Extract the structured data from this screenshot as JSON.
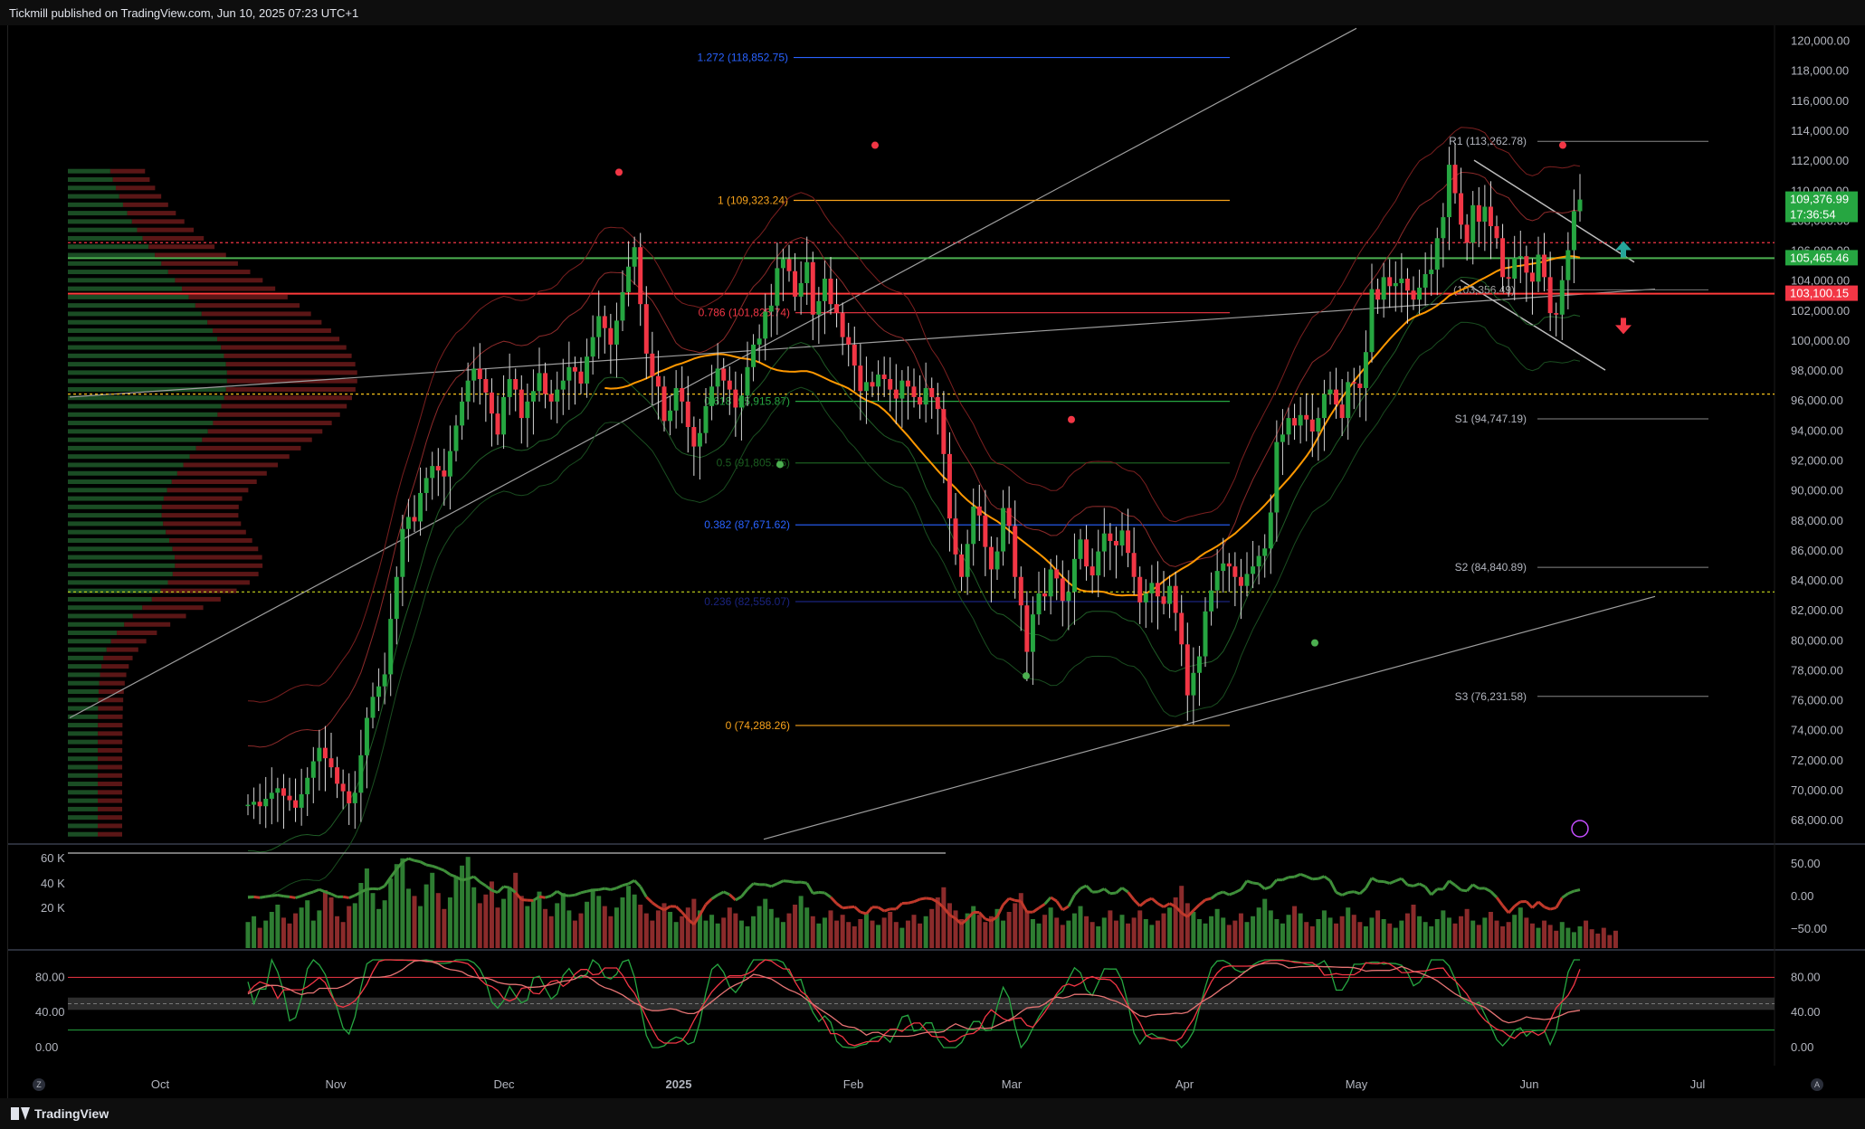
{
  "header": {
    "publisher": "Tickmill published on TradingView.com, Jun 10, 2025 07:23 UTC+1"
  },
  "footer": {
    "brand": "TradingView",
    "left_btn": "Z",
    "right_btn": "A"
  },
  "colors": {
    "up": "#26a641",
    "down": "#f23645",
    "fib_blue": "#2962ff",
    "fib_orange": "#f7a21b",
    "green_line": "#4caf50",
    "red_line": "#ff3b3b",
    "ma": "#ff9800"
  },
  "chart_data": {
    "type": "candlestick",
    "title": "",
    "xlabel": "",
    "ylabel": "",
    "x_ticks": [
      "Oct",
      "Nov",
      "Dec",
      "2025",
      "Feb",
      "Mar",
      "Apr",
      "May",
      "Jun",
      "Jul"
    ],
    "y_ticks": [
      "120,000.00",
      "118,000.00",
      "116,000.00",
      "114,000.00",
      "112,000.00",
      "110,000.00",
      "108,000.00",
      "106,000.00",
      "104,000.00",
      "102,000.00",
      "100,000.00",
      "98,000.00",
      "96,000.00",
      "94,000.00",
      "92,000.00",
      "90,000.00",
      "88,000.00",
      "86,000.00",
      "84,000.00",
      "82,000.00",
      "80,000.00",
      "78,000.00",
      "76,000.00",
      "74,000.00",
      "72,000.00",
      "70,000.00",
      "68,000.00"
    ],
    "ylim": [
      66500,
      121000
    ],
    "price_badges": [
      {
        "label": "109,376.99",
        "sub": "17:36:54",
        "value": 109376.99,
        "color": "#26a641"
      },
      {
        "label": "105,465.46",
        "value": 105465.46,
        "color": "#26a641"
      },
      {
        "label": "103,100.15",
        "value": 103100.15,
        "color": "#f23645"
      }
    ],
    "fib_levels": [
      {
        "label": "1.272 (118,852.75)",
        "value": 118852.75,
        "color": "#2962ff"
      },
      {
        "label": "1 (109,323.24)",
        "value": 109323.24,
        "color": "#f7a21b"
      },
      {
        "label": "0.786 (101,825.74)",
        "value": 101825.74,
        "color": "#f23645"
      },
      {
        "label": "0.618 (95,915.87)",
        "value": 95915.87,
        "color": "#26a641"
      },
      {
        "label": "0.5 (91,805.75)",
        "value": 91805.75,
        "color": "#1b5e20"
      },
      {
        "label": "0.382 (87,671.62)",
        "value": 87671.62,
        "color": "#2962ff"
      },
      {
        "label": "0.236 (82,556.07)",
        "value": 82556.07,
        "color": "#1a237e"
      },
      {
        "label": "0 (74,288.26)",
        "value": 74288.26,
        "color": "#f7a21b"
      }
    ],
    "pivot_levels": [
      {
        "label": "R1 (113,262.78)",
        "value": 113262.78
      },
      {
        "label": "S1 (94,747.19)",
        "value": 94747.19
      },
      {
        "label": "S2 (84,840.89)",
        "value": 84840.89
      },
      {
        "label": "S3 (76,231.58)",
        "value": 76231.58
      },
      {
        "label": "(103,356.49)",
        "value": 103356.49
      }
    ],
    "hlines": [
      {
        "value": 105465.46,
        "color": "#4caf50",
        "style": "solid"
      },
      {
        "value": 103100.15,
        "color": "#ff3b3b",
        "style": "solid"
      },
      {
        "value": 106500,
        "color": "#f23645",
        "style": "dotted"
      },
      {
        "value": 96400,
        "color": "#f7c21b",
        "style": "dotted"
      },
      {
        "value": 83200,
        "color": "#c6d61b",
        "style": "dotted"
      }
    ],
    "closes": [
      69000,
      69200,
      68900,
      69400,
      69800,
      70100,
      69600,
      69300,
      68800,
      69700,
      70800,
      71900,
      72800,
      72100,
      71500,
      70400,
      69900,
      69100,
      69800,
      72300,
      74800,
      76200,
      76900,
      77700,
      81400,
      84200,
      87400,
      88200,
      87900,
      89800,
      90800,
      91600,
      91300,
      90900,
      92600,
      94300,
      95900,
      97300,
      98100,
      97400,
      96500,
      95100,
      93700,
      96200,
      97400,
      96700,
      94800,
      95900,
      96600,
      97800,
      96400,
      95900,
      96700,
      97300,
      98200,
      97900,
      97100,
      98900,
      100200,
      101600,
      100800,
      99700,
      101300,
      103200,
      104900,
      106200,
      102400,
      99100,
      97600,
      96900,
      94600,
      95300,
      96800,
      95900,
      94200,
      92900,
      93800,
      95600,
      96900,
      98100,
      97300,
      96700,
      95500,
      96300,
      98200,
      99700,
      100100,
      101900,
      102300,
      104800,
      105400,
      104600,
      102900,
      103800,
      105200,
      101700,
      102600,
      104100,
      102400,
      101800,
      100200,
      99700,
      98300,
      96600,
      97200,
      96900,
      97700,
      97400,
      96700,
      96100,
      97300,
      96900,
      96200,
      95700,
      96800,
      96200,
      95400,
      92400,
      88100,
      85700,
      84200,
      86400,
      88900,
      88300,
      86200,
      84700,
      85900,
      88800,
      87600,
      84200,
      82300,
      79200,
      81700,
      83100,
      82900,
      84700,
      84100,
      82600,
      83200,
      85400,
      86700,
      84900,
      84300,
      85900,
      87100,
      86600,
      86300,
      87300,
      85800,
      84200,
      82500,
      83100,
      83800,
      82900,
      82400,
      83600,
      81800,
      79700,
      76300,
      77800,
      78900,
      81900,
      83300,
      84600,
      85100,
      84900,
      84200,
      83600,
      84400,
      84900,
      85600,
      86100,
      88500,
      93200,
      93700,
      94800,
      94300,
      95000,
      94700,
      93900,
      94800,
      96400,
      96700,
      95700,
      94800,
      97200,
      97100,
      96800,
      99200,
      103400,
      102700,
      104200,
      103600,
      103800,
      104100,
      103300,
      102700,
      103500,
      104400,
      104700,
      106800,
      108200,
      111700,
      109800,
      107700,
      106500,
      109000,
      107900,
      108900,
      107600,
      106800,
      104200,
      104100,
      105500,
      105600,
      104500,
      103900,
      105700,
      104200,
      101800,
      101700,
      104000,
      106000,
      108600,
      109377
    ],
    "volume_bars": [
      18,
      22,
      14,
      19,
      25,
      30,
      21,
      17,
      24,
      28,
      33,
      19,
      26,
      40,
      35,
      22,
      18,
      29,
      31,
      45,
      55,
      38,
      27,
      33,
      48,
      58,
      62,
      41,
      36,
      29,
      44,
      52,
      38,
      27,
      35,
      49,
      57,
      63,
      42,
      31,
      37,
      46,
      28,
      34,
      41,
      52,
      36,
      29,
      33,
      39,
      27,
      22,
      31,
      38,
      26,
      19,
      24,
      32,
      41,
      36,
      29,
      22,
      28,
      35,
      43,
      37,
      30,
      24,
      19,
      26,
      31,
      25,
      18,
      22,
      28,
      34,
      26,
      19,
      23,
      17,
      21,
      28,
      24,
      19,
      15,
      22,
      29,
      34,
      27,
      21,
      18,
      24,
      30,
      36,
      28,
      22,
      17,
      21,
      26,
      19,
      23,
      18,
      15,
      20,
      24,
      19,
      16,
      21,
      25,
      18,
      14,
      19,
      23,
      17,
      22,
      27,
      35,
      42,
      31,
      26,
      20,
      24,
      29,
      23,
      18,
      22,
      27,
      19,
      25,
      31,
      38,
      26,
      20,
      17,
      23,
      28,
      21,
      16,
      19,
      24,
      29,
      22,
      18,
      15,
      21,
      26,
      19,
      23,
      17,
      21,
      26,
      20,
      16,
      19,
      24,
      28,
      35,
      43,
      31,
      25,
      20,
      17,
      22,
      27,
      21,
      16,
      19,
      24,
      18,
      22,
      28,
      34,
      26,
      20,
      17,
      23,
      29,
      24,
      18,
      15,
      20,
      26,
      21,
      17,
      22,
      28,
      23,
      18,
      15,
      21,
      26,
      20,
      17,
      14,
      19,
      24,
      30,
      22,
      18,
      15,
      20,
      26,
      21,
      17,
      22,
      27,
      19,
      16,
      21,
      25,
      19,
      15,
      18,
      23,
      28,
      21,
      17,
      14,
      19,
      16,
      12,
      18,
      14,
      11,
      15,
      19,
      13,
      10,
      14,
      9,
      12
    ],
    "osc_labels_vol": [
      "60 K",
      "40 K",
      "20 K"
    ],
    "osc_labels_mom": [
      "50.00",
      "0.00",
      "−50.00"
    ],
    "stoch_labels_left": [
      "80.00",
      "40.00",
      "0.00"
    ],
    "stoch_labels_right": [
      "80.00",
      "40.00",
      "0.00"
    ]
  }
}
